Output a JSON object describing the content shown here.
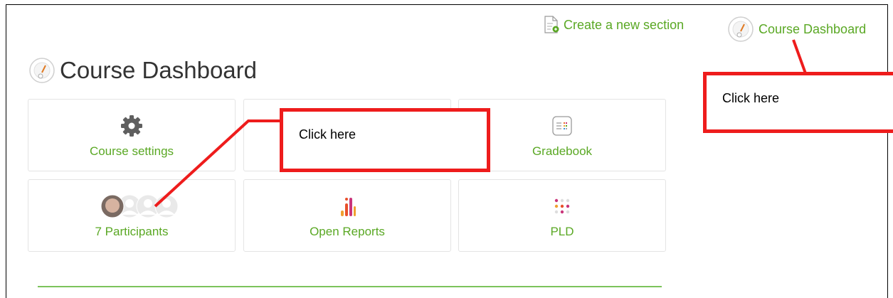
{
  "header": {
    "create_section_label": "Create a new section",
    "dashboard_link_label": "Course Dashboard"
  },
  "page": {
    "title": "Course Dashboard"
  },
  "tiles": [
    {
      "label": "Course settings",
      "icon": "gear-icon"
    },
    {
      "label": "",
      "icon": ""
    },
    {
      "label": "Gradebook",
      "icon": "gradebook-icon"
    },
    {
      "label": "7 Participants",
      "icon": "participants-avatars-icon"
    },
    {
      "label": "Open Reports",
      "icon": "reports-bar-icon"
    },
    {
      "label": "PLD",
      "icon": "pld-dots-icon"
    }
  ],
  "callouts": {
    "center": "Click here",
    "right": "Click here"
  },
  "colors": {
    "link_green": "#5aa824",
    "callout_red": "#ee1c1c"
  }
}
